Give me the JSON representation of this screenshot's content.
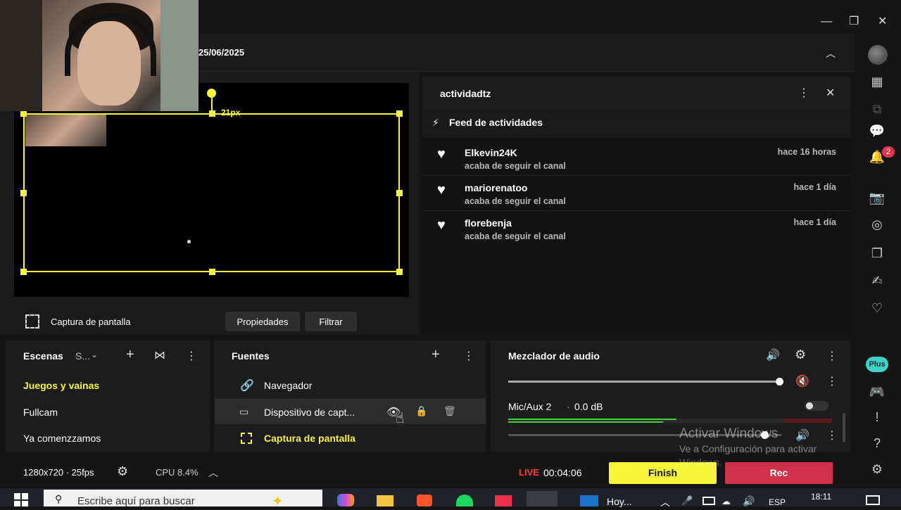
{
  "window": {
    "date": "25/06/2025",
    "controls": {
      "minimize": "—",
      "restore": "❐",
      "close": "✕"
    }
  },
  "preview": {
    "size_label": "21px",
    "selected_source": "Captura de pantalla",
    "properties_label": "Propiedades",
    "filter_label": "Filtrar"
  },
  "activity": {
    "channel": "actividadtz",
    "feed_title": "Feed de actividades",
    "items": [
      {
        "user": "Elkevin24K",
        "action": "acaba de seguir el canal",
        "time": "hace 16 horas"
      },
      {
        "user": "mariorenatoo",
        "action": "acaba de seguir el canal",
        "time": "hace 1 día"
      },
      {
        "user": "florebenja",
        "action": "acaba de seguir el canal",
        "time": "hace 1 día"
      }
    ]
  },
  "scenes": {
    "title": "Escenas",
    "collection": "S...",
    "items": [
      "Juegos y vainas",
      "Fullcam",
      "Ya comenzzamos"
    ],
    "active": "Juegos y vainas"
  },
  "sources": {
    "title": "Fuentes",
    "items": [
      "Navegador",
      "Dispositivo de capt...",
      "Captura de pantalla"
    ]
  },
  "mixer": {
    "title": "Mezclador de audio",
    "channel_name": "Mic/Aux 2",
    "channel_db": "0.0 dB",
    "master_volume": 1.0,
    "channel_volume": 0.94,
    "meter_level": 0.61
  },
  "status": {
    "resolution": "1280x720 · 25fps",
    "cpu": "CPU 8.4%",
    "live_label": "LIVE",
    "live_time": "00:04:06",
    "finish_label": "Finish",
    "rec_label": "Rec"
  },
  "sidebar": {
    "notification_count": "2",
    "plus_label": "Plus"
  },
  "watermark": {
    "title": "Activar Windows",
    "subtitle": "Ve a Configuración para activar",
    "subtitle2": "Windows."
  },
  "taskbar": {
    "search_placeholder": "Escribe aquí para buscar",
    "app_label": "Hoy...",
    "language": "ESP",
    "time": "18:11"
  },
  "colors": {
    "accent_yellow": "#f5f53a",
    "rec_red": "#d0304a",
    "live_red": "#ff3b3b"
  }
}
